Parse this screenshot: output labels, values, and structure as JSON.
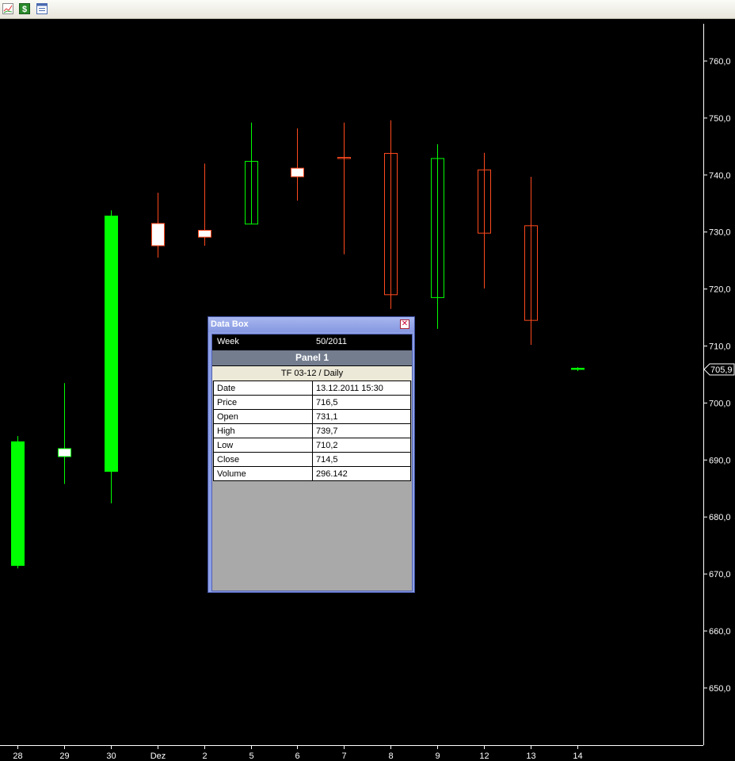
{
  "toolbar": {
    "icons": [
      "chart-icon",
      "dollar-icon",
      "window-icon"
    ],
    "dollar_glyph": "$"
  },
  "chart_data": {
    "type": "candlestick",
    "x_labels": [
      "28",
      "29",
      "30",
      "Dez",
      "2",
      "5",
      "6",
      "7",
      "8",
      "9",
      "12",
      "13",
      "14"
    ],
    "y_ticks": [
      "760,0",
      "750,0",
      "740,0",
      "730,0",
      "720,0",
      "710,0",
      "700,0",
      "690,0",
      "680,0",
      "670,0",
      "660,0",
      "650,0"
    ],
    "ylim": [
      640,
      770
    ],
    "last_price_label": "705,9",
    "last_price": 705.9,
    "candles": [
      {
        "x": "28",
        "open": 671.5,
        "high": 694.2,
        "low": 671.0,
        "close": 693.2,
        "color": "#00ff00",
        "filled": true
      },
      {
        "x": "29",
        "open": 692.0,
        "high": 703.5,
        "low": 685.8,
        "close": 690.6,
        "color": "#ffffff",
        "filled": true
      },
      {
        "x": "30",
        "open": 688.0,
        "high": 733.8,
        "low": 682.4,
        "close": 732.8,
        "color": "#00ff00",
        "filled": true
      },
      {
        "x": "Dez",
        "open": 727.6,
        "high": 736.9,
        "low": 725.5,
        "close": 731.5,
        "color": "#ff4a1e",
        "filled": true
      },
      {
        "x": "2",
        "open": 729.1,
        "high": 742.0,
        "low": 727.6,
        "close": 730.3,
        "color": "#ff4a1e",
        "filled": true
      },
      {
        "x": "5",
        "open": 731.4,
        "high": 749.2,
        "low": 731.4,
        "close": 742.4,
        "color": "#00ff00",
        "filled": false
      },
      {
        "x": "6",
        "open": 741.2,
        "high": 748.2,
        "low": 735.5,
        "close": 739.7,
        "color": "#ff4a1e",
        "filled": true
      },
      {
        "x": "7",
        "open": 743.1,
        "high": 749.2,
        "low": 726.1,
        "close": 742.9,
        "color": "#ff4a1e",
        "filled": false
      },
      {
        "x": "8",
        "open": 743.8,
        "high": 749.6,
        "low": 716.5,
        "close": 719.0,
        "color": "#ff4a1e",
        "filled": false
      },
      {
        "x": "9",
        "open": 718.5,
        "high": 745.4,
        "low": 713.0,
        "close": 742.9,
        "color": "#00ff00",
        "filled": false
      },
      {
        "x": "12",
        "open": 740.9,
        "high": 743.9,
        "low": 720.1,
        "close": 729.8,
        "color": "#ff4a1e",
        "filled": false
      },
      {
        "x": "13",
        "open": 731.1,
        "high": 739.7,
        "low": 710.2,
        "close": 714.5,
        "color": "#ff4a1e",
        "filled": false
      },
      {
        "x": "14",
        "open": 706.1,
        "high": 706.3,
        "low": 705.6,
        "close": 705.9,
        "color": "#00ff00",
        "filled": true
      }
    ]
  },
  "databox": {
    "title": "Data Box",
    "close_glyph": "✕",
    "week_label": "Week",
    "week_value": "50/2011",
    "panel_title": "Panel 1",
    "instrument": "TF 03-12 / Daily",
    "rows": [
      {
        "label": "Date",
        "value": "13.12.2011 15:30"
      },
      {
        "label": "Price",
        "value": "716,5"
      },
      {
        "label": "Open",
        "value": "731,1"
      },
      {
        "label": "High",
        "value": "739,7"
      },
      {
        "label": "Low",
        "value": "710,2"
      },
      {
        "label": "Close",
        "value": "714,5"
      },
      {
        "label": "Volume",
        "value": "296.142"
      }
    ]
  }
}
